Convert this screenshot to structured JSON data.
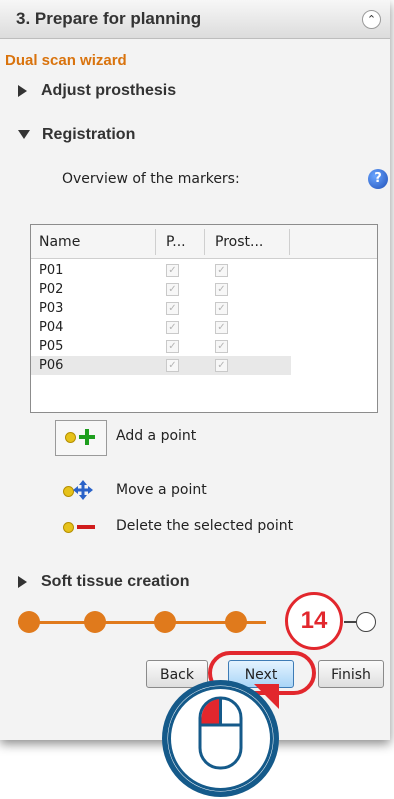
{
  "header": {
    "title": "3. Prepare for planning",
    "collapse_glyph": "»"
  },
  "wizard_title": "Dual scan wizard",
  "sections": {
    "adjust": "Adjust prosthesis",
    "registration": "Registration",
    "soft_tissue": "Soft tissue creation"
  },
  "overview_label": "Overview of the markers:",
  "help_icon": "?",
  "table": {
    "columns": [
      "Name",
      "P...",
      "Prost..."
    ],
    "rows": [
      {
        "name": "P01"
      },
      {
        "name": "P02"
      },
      {
        "name": "P03"
      },
      {
        "name": "P04"
      },
      {
        "name": "P05"
      },
      {
        "name": "P06"
      }
    ]
  },
  "tools": {
    "add": "Add a point",
    "move": "Move a point",
    "delete": "Delete the selected point"
  },
  "step_badge": "14",
  "buttons": {
    "back": "Back",
    "next": "Next",
    "finish": "Finish"
  },
  "colors": {
    "accent": "#e07a1c",
    "highlight": "#e2272d",
    "mouse_bg": "#155a8a"
  }
}
